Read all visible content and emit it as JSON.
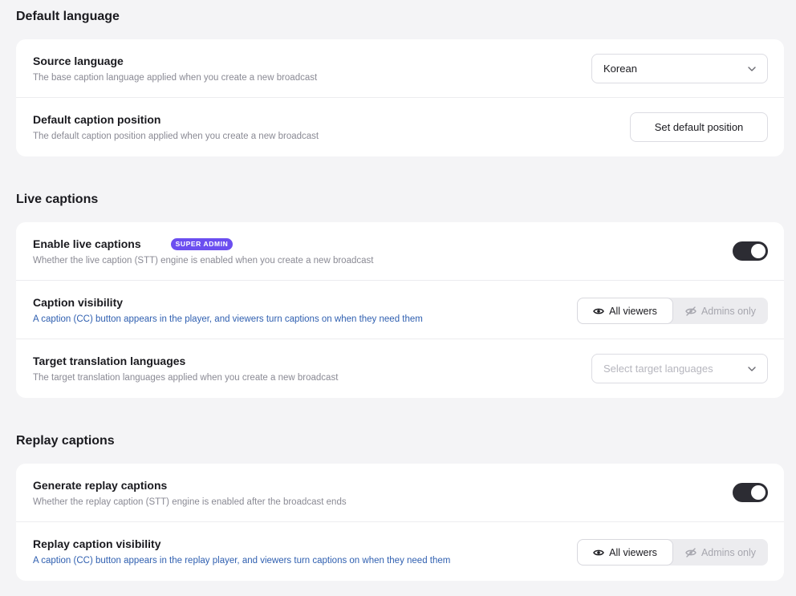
{
  "sections": {
    "default_language": {
      "title": "Default language",
      "source_language": {
        "title": "Source language",
        "desc": "The base caption language applied when you create a new broadcast",
        "value": "Korean"
      },
      "caption_position": {
        "title": "Default caption position",
        "desc": "The default caption position applied when you create a new broadcast",
        "button_label": "Set default position"
      }
    },
    "live_captions": {
      "title": "Live captions",
      "enable": {
        "title": "Enable live captions",
        "badge": "SUPER ADMIN",
        "desc": "Whether the live caption (STT) engine is enabled when you create a new broadcast",
        "enabled": true
      },
      "visibility": {
        "title": "Caption visibility",
        "desc": "A caption (CC) button appears in the player, and viewers turn captions on when they need them",
        "options": [
          "All viewers",
          "Admins only"
        ],
        "selected": "All viewers"
      },
      "target_languages": {
        "title": "Target translation languages",
        "desc": "The target translation languages applied when you create a new broadcast",
        "placeholder": "Select target languages"
      }
    },
    "replay_captions": {
      "title": "Replay captions",
      "generate": {
        "title": "Generate replay captions",
        "desc": "Whether the replay caption (STT) engine is enabled after the broadcast ends",
        "enabled": true
      },
      "visibility": {
        "title": "Replay caption visibility",
        "desc": "A caption (CC) button appears in the replay player, and viewers turn captions on when they need them",
        "options": [
          "All viewers",
          "Admins only"
        ],
        "selected": "All viewers"
      }
    }
  },
  "icons": {
    "chevron": "chevron-down-icon",
    "eye": "eye-icon",
    "eye_off": "eye-off-icon"
  },
  "colors": {
    "badge": "#6b4ef0",
    "toggle_on": "#2c2c33",
    "link_desc": "#2f5fb0"
  }
}
